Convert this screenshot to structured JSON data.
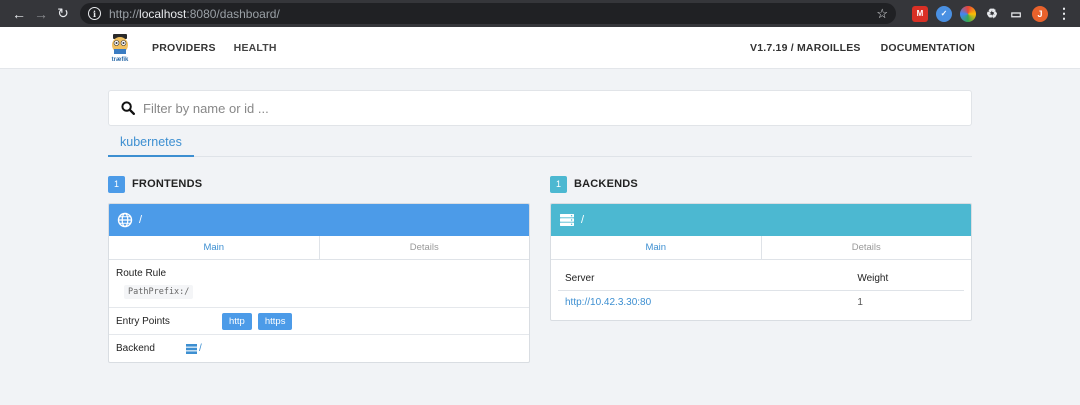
{
  "browser": {
    "url_prefix": "http://",
    "url_host": "localhost",
    "url_rest": ":8080/dashboard/",
    "avatar_letter": "J",
    "icons": [
      "back-icon",
      "forward-icon",
      "reload-icon",
      "info-icon",
      "star-icon",
      "extension-icon",
      "puzzle-icon",
      "cast-icon",
      "menu-icon"
    ]
  },
  "header": {
    "logo_text": "træfik",
    "nav": [
      {
        "label": "PROVIDERS"
      },
      {
        "label": "HEALTH"
      }
    ],
    "version": "V1.7.19 / MAROILLES",
    "documentation": "DOCUMENTATION"
  },
  "search": {
    "placeholder": "Filter by name or id ..."
  },
  "providers": {
    "active_tab": "kubernetes"
  },
  "frontends": {
    "count": "1",
    "title": "FRONTENDS",
    "panel": {
      "name": "/",
      "tabs": [
        "Main",
        "Details"
      ],
      "route_rule_label": "Route Rule",
      "route_rule": "PathPrefix:/",
      "entry_points_label": "Entry Points",
      "entry_points": [
        "http",
        "https"
      ],
      "backend_label": "Backend",
      "backend_value": "/"
    }
  },
  "backends": {
    "count": "1",
    "title": "BACKENDS",
    "panel": {
      "name": "/",
      "tabs": [
        "Main",
        "Details"
      ],
      "columns": [
        "Server",
        "Weight"
      ],
      "servers": [
        {
          "url": "http://10.42.3.30:80",
          "weight": "1"
        }
      ]
    }
  },
  "colors": {
    "frontend_accent": "#4c9be8",
    "backend_accent": "#4cb8d1",
    "link": "#3d8fd1"
  }
}
